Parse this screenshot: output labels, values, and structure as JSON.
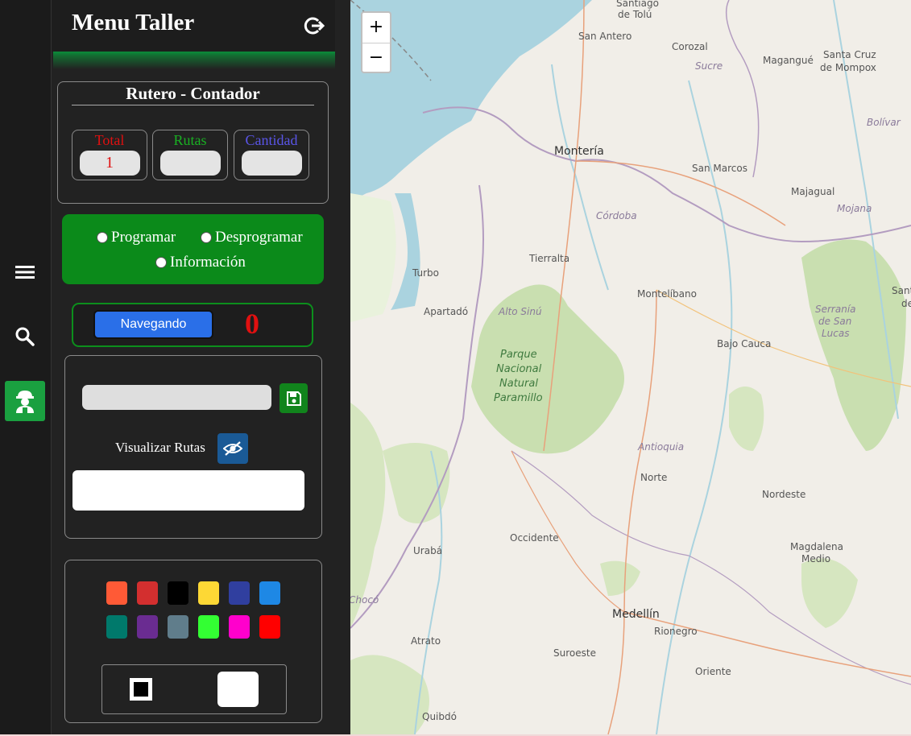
{
  "panel": {
    "title": "Menu Taller"
  },
  "counter": {
    "title": "Rutero - Contador",
    "items": [
      {
        "label": "Total",
        "value": "1",
        "color": "#e01010"
      },
      {
        "label": "Rutas",
        "value": "",
        "color": "#19b022"
      },
      {
        "label": "Cantidad",
        "value": "",
        "color": "#5a55e8"
      }
    ]
  },
  "radios": {
    "programar": "Programar",
    "desprogramar": "Desprogramar",
    "informacion": "Información"
  },
  "navigation": {
    "button_label": "Navegando",
    "count": "0"
  },
  "routes": {
    "input_value": "",
    "visualize_label": "Visualizar Rutas",
    "field_value": ""
  },
  "palette": [
    "#ff5a36",
    "#d32f2f",
    "#000000",
    "#fdd835",
    "#303f9f",
    "#1e88e5",
    "#00796b",
    "#6a2c91",
    "#607d8b",
    "#33ff33",
    "#ff00cc",
    "#ff0000"
  ],
  "rail_icons": [
    "menu-icon",
    "search-icon",
    "worker-icon"
  ],
  "map": {
    "zoom_in": "+",
    "zoom_out": "−",
    "labels": {
      "santiago": "Santiago",
      "de_tolu": "de Tolú",
      "san_antero": "San Antero",
      "corozal": "Corozal",
      "sucre": "Sucre",
      "magangue": "Magangué",
      "santa_cruz": "Santa Cruz",
      "de_mompox": "de Mompox",
      "bolivar": "Bolívar",
      "monteria": "Montería",
      "san_marcos": "San Marcos",
      "majagual": "Majagual",
      "cordoba": "Córdoba",
      "mojana": "Mojana",
      "tierralta": "Tierralta",
      "turbo": "Turbo",
      "montelibano": "Montelíbano",
      "apartado": "Apartadó",
      "alto_sinu": "Alto Sinú",
      "serrania": "Serranía",
      "de_san": "de San",
      "lucas": "Lucas",
      "bajo_cauca": "Bajo Cauca",
      "parque": "Parque",
      "nacional": "Nacional",
      "natural": "Natural",
      "paramillo": "Paramillo",
      "antioquia": "Antioquia",
      "norte": "Norte",
      "nordeste": "Nordeste",
      "occidente": "Occidente",
      "uraba": "Urabá",
      "magdalena": "Magdalena",
      "medio": "Medio",
      "choco": "Chocó",
      "medellin": "Medellín",
      "rionegro": "Rionegro",
      "atrato": "Atrato",
      "suroeste": "Suroeste",
      "oriente": "Oriente",
      "quibdo": "Quibdó",
      "sant": "Sant",
      "de": "de"
    }
  }
}
